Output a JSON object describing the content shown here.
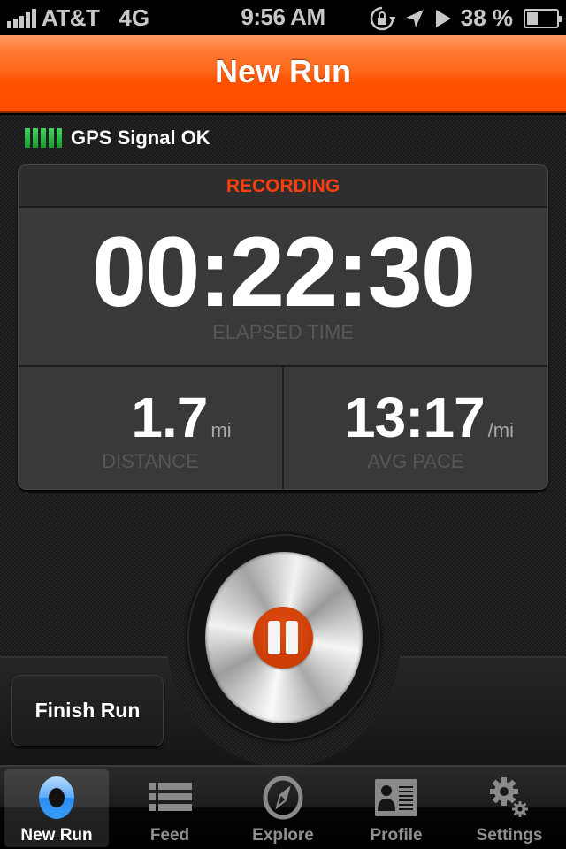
{
  "status_bar": {
    "carrier": "AT&T",
    "network": "4G",
    "time": "9:56 AM",
    "battery_percent_text": "38 %",
    "battery_level": 0.38,
    "signal_bars": 5,
    "icons": [
      "rotation-lock-icon",
      "location-arrow-icon",
      "play-icon",
      "battery-icon"
    ]
  },
  "nav": {
    "title": "New Run",
    "accent_color": "#ff5200"
  },
  "gps": {
    "status": "GPS Signal OK",
    "bars": 5,
    "color": "#2fc04a"
  },
  "panel": {
    "state": "RECORDING",
    "state_color": "#ff3d0f",
    "elapsed": {
      "value": "00:22:30",
      "label": "ELAPSED TIME"
    },
    "distance": {
      "value": "1.7",
      "unit": "mi",
      "label": "DISTANCE"
    },
    "pace": {
      "value": "13:17",
      "unit": "/mi",
      "label": "AVG PACE"
    }
  },
  "controls": {
    "finish_label": "Finish Run",
    "pause_icon": "pause-icon"
  },
  "tabs": [
    {
      "label": "New Run",
      "icon": "new-run-icon",
      "active": true
    },
    {
      "label": "Feed",
      "icon": "list-icon",
      "active": false
    },
    {
      "label": "Explore",
      "icon": "compass-icon",
      "active": false
    },
    {
      "label": "Profile",
      "icon": "profile-card-icon",
      "active": false
    },
    {
      "label": "Settings",
      "icon": "gears-icon",
      "active": false
    }
  ]
}
